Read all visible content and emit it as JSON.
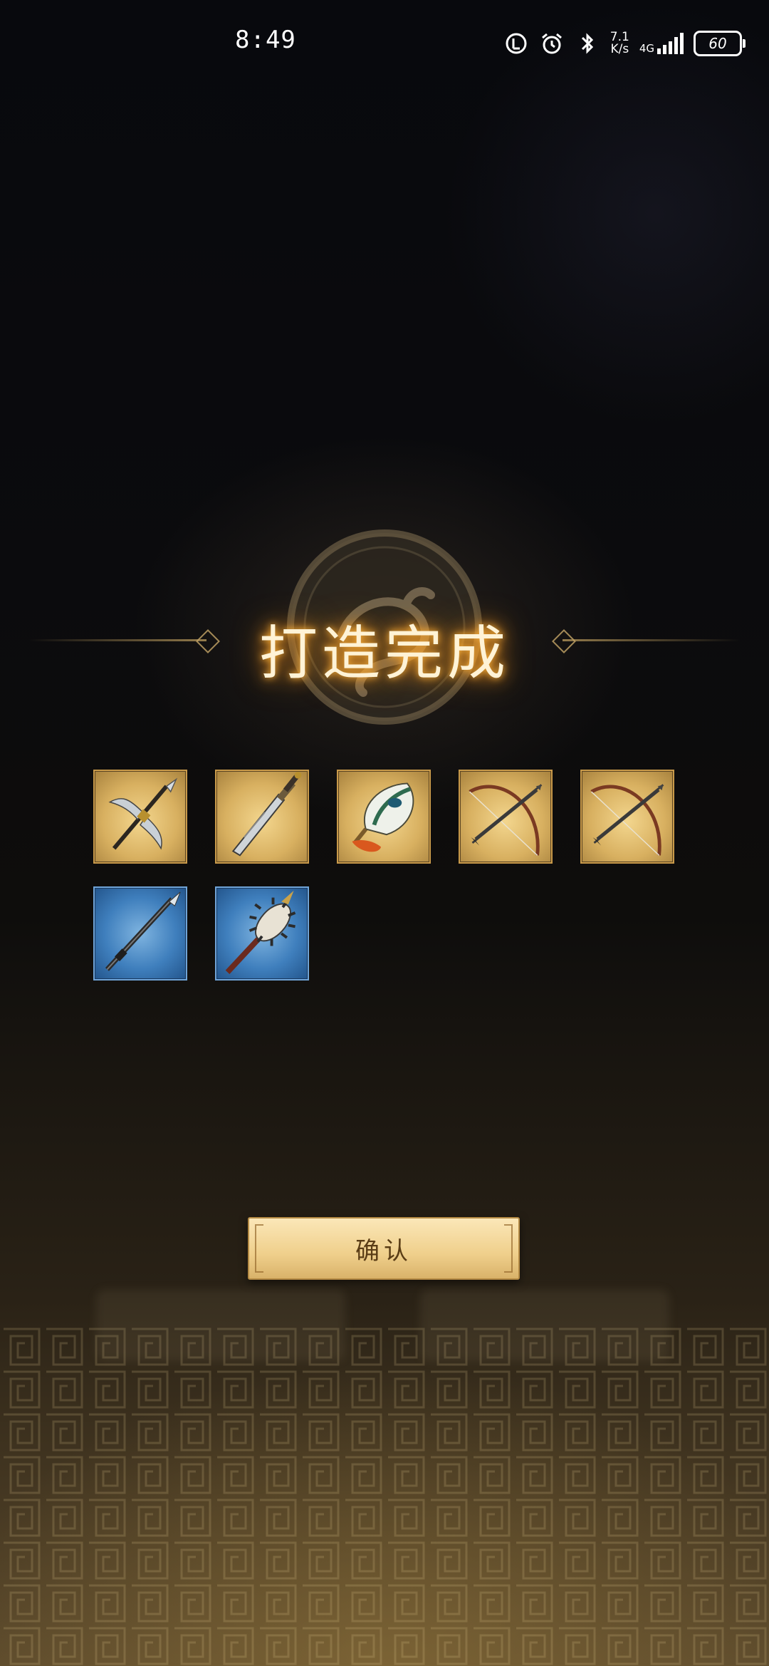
{
  "status_bar": {
    "time": "8:49",
    "net_speed_value": "7.1",
    "net_speed_unit": "K/s",
    "network_type": "4G",
    "battery": "60"
  },
  "dialog": {
    "title": "打造完成",
    "confirm_label": "确认"
  },
  "items": [
    {
      "icon": "halberd-icon",
      "rarity": "gold"
    },
    {
      "icon": "sword-icon",
      "rarity": "gold"
    },
    {
      "icon": "feather-fan-icon",
      "rarity": "gold"
    },
    {
      "icon": "bow-icon",
      "rarity": "gold"
    },
    {
      "icon": "bow-icon",
      "rarity": "gold"
    },
    {
      "icon": "spear-icon",
      "rarity": "blue"
    },
    {
      "icon": "spiked-mace-icon",
      "rarity": "blue"
    }
  ],
  "colors": {
    "title_glow": "#ffb43a",
    "gold_frame": "#c99a4a",
    "blue_frame": "#6fa4d8",
    "button_text": "#5a3d16"
  }
}
